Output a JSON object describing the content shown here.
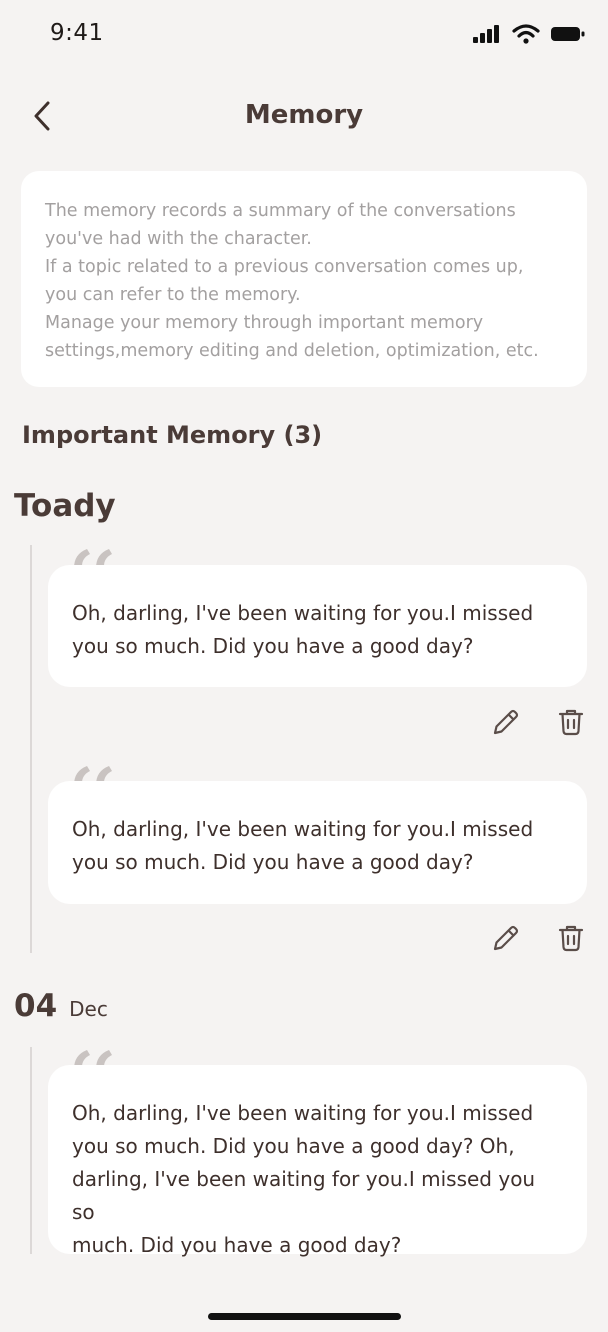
{
  "status_bar": {
    "time": "9:41"
  },
  "nav": {
    "title": "Memory"
  },
  "info": {
    "lines": [
      "The memory records a summary of the conversations",
      "you've had with the character.",
      "If a topic related to a previous conversation comes up,",
      "you can refer to the memory.",
      "Manage your memory through important memory",
      "settings,memory editing and deletion, optimization, etc."
    ]
  },
  "important": {
    "title": "Important Memory (3)"
  },
  "groups": [
    {
      "label": "Toady",
      "memories": [
        {
          "lines": [
            "Oh, darling, I've been waiting for you.I missed",
            "you so much. Did you have a good day?"
          ]
        },
        {
          "lines": [
            "Oh, darling, I've been waiting for you.I missed",
            "you so much. Did you have a good day?"
          ]
        }
      ]
    },
    {
      "day": "04",
      "month": "Dec",
      "memories": [
        {
          "lines": [
            "Oh, darling, I've been waiting for you.I missed",
            "you so much. Did you have a good day? Oh,",
            "darling, I've been waiting for you.I missed you so",
            "much. Did you have a good day?"
          ]
        }
      ]
    }
  ],
  "colors": {
    "accent": "#4a3b37",
    "muted": "#a3a0a0",
    "background": "#f5f3f2",
    "card": "#ffffff",
    "quote": "#c9c3c1"
  },
  "icons": [
    "back-chevron-icon",
    "signal-icon",
    "wifi-icon",
    "battery-icon",
    "quote-icon",
    "edit-pencil-icon",
    "trash-icon"
  ]
}
